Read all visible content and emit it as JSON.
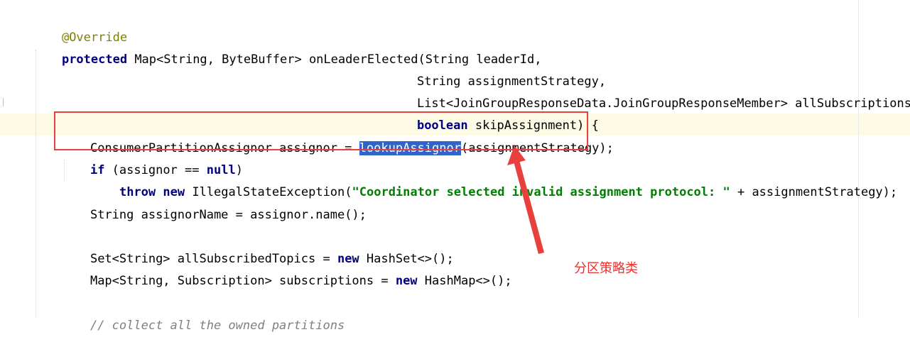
{
  "code": {
    "line1": {
      "annotation": "@Override"
    },
    "line2": {
      "kw_protected": "protected",
      "rest": " Map<String, ByteBuffer> onLeaderElected(String leaderId,"
    },
    "line3": {
      "text": "String assignmentStrategy,"
    },
    "line4": {
      "text": "List<JoinGroupResponseData.JoinGroupResponseMember> allSubscriptions,"
    },
    "line5": {
      "kw_boolean": "boolean",
      "rest": " skipAssignment) {"
    },
    "line6": {
      "pre": "ConsumerPartitionAssignor assignor = ",
      "selected": "lookupAssignor",
      "post": "(assignmentStrategy);"
    },
    "line7": {
      "kw_if": "if",
      "mid": " (assignor == ",
      "kw_null": "null",
      "post": ")"
    },
    "line8": {
      "kw_throw": "throw",
      "sp1": " ",
      "kw_new": "new",
      "mid": " IllegalStateException(",
      "string": "\"Coordinator selected invalid assignment protocol: \"",
      "post": " + assignmentStrategy);"
    },
    "line9": {
      "text": "String assignorName = assignor.name();"
    },
    "line10": {
      "pre": "Set<String> allSubscribedTopics = ",
      "kw_new": "new",
      "post": " HashSet<>();"
    },
    "line11": {
      "pre": "Map<String, Subscription> subscriptions = ",
      "kw_new": "new",
      "post": " HashMap<>();"
    },
    "line12": {
      "comment": "// collect all the owned partitions"
    }
  },
  "annotation_label": "分区策略类",
  "colors": {
    "keyword": "#000080",
    "annotation": "#808000",
    "string": "#008000",
    "comment": "#808080",
    "selection": "#2f65ca",
    "callout": "#e8302c"
  }
}
